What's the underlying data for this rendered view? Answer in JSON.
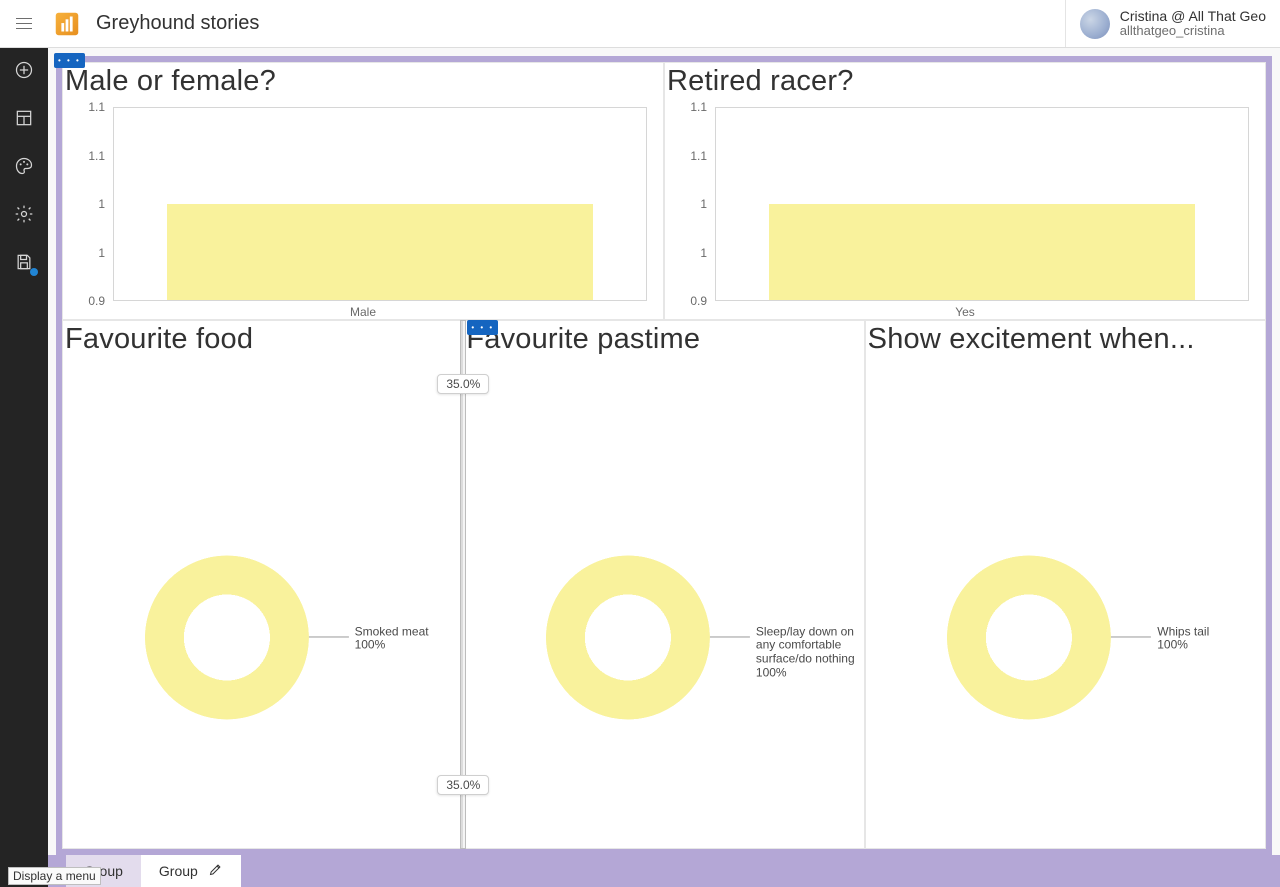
{
  "header": {
    "app_title": "Greyhound stories",
    "menu_tooltip": "Display a menu"
  },
  "user": {
    "display_name": "Cristina @ All That Geo",
    "handle": "allthatgeo_cristina"
  },
  "sidebar": {
    "items": [
      "Add",
      "Layout",
      "Theme",
      "Settings",
      "Save"
    ]
  },
  "tabs": {
    "inactive_label": "Group",
    "active_label": "Group"
  },
  "splitter": {
    "top_pct": "35.0%",
    "bottom_pct": "35.0%"
  },
  "cards": {
    "top_left": {
      "title": "Male or female?"
    },
    "top_right": {
      "title": "Retired racer?"
    },
    "bot_left": {
      "title": "Favourite food",
      "donut_label": "Smoked meat 100%"
    },
    "bot_mid": {
      "title": "Favourite pastime",
      "donut_label": "Sleep/lay down on any comfortable surface/do nothing 100%"
    },
    "bot_right": {
      "title": "Show excitement when...",
      "donut_label": "Whips tail 100%"
    }
  },
  "chart_data": [
    {
      "type": "bar",
      "title": "Male or female?",
      "categories": [
        "Male"
      ],
      "values": [
        1
      ],
      "ylim": [
        0.9,
        1.1
      ],
      "yticks": [
        0.9,
        1,
        1,
        1.1,
        1.1
      ],
      "xlabel": "",
      "ylabel": ""
    },
    {
      "type": "bar",
      "title": "Retired racer?",
      "categories": [
        "Yes"
      ],
      "values": [
        1
      ],
      "ylim": [
        0.9,
        1.1
      ],
      "yticks": [
        0.9,
        1,
        1,
        1.1,
        1.1
      ],
      "xlabel": "",
      "ylabel": ""
    },
    {
      "type": "pie",
      "title": "Favourite food",
      "series": [
        {
          "name": "Smoked meat",
          "value": 100
        }
      ]
    },
    {
      "type": "pie",
      "title": "Favourite pastime",
      "series": [
        {
          "name": "Sleep/lay down on any comfortable surface/do nothing",
          "value": 100
        }
      ]
    },
    {
      "type": "pie",
      "title": "Show excitement when...",
      "series": [
        {
          "name": "Whips tail",
          "value": 100
        }
      ]
    }
  ]
}
